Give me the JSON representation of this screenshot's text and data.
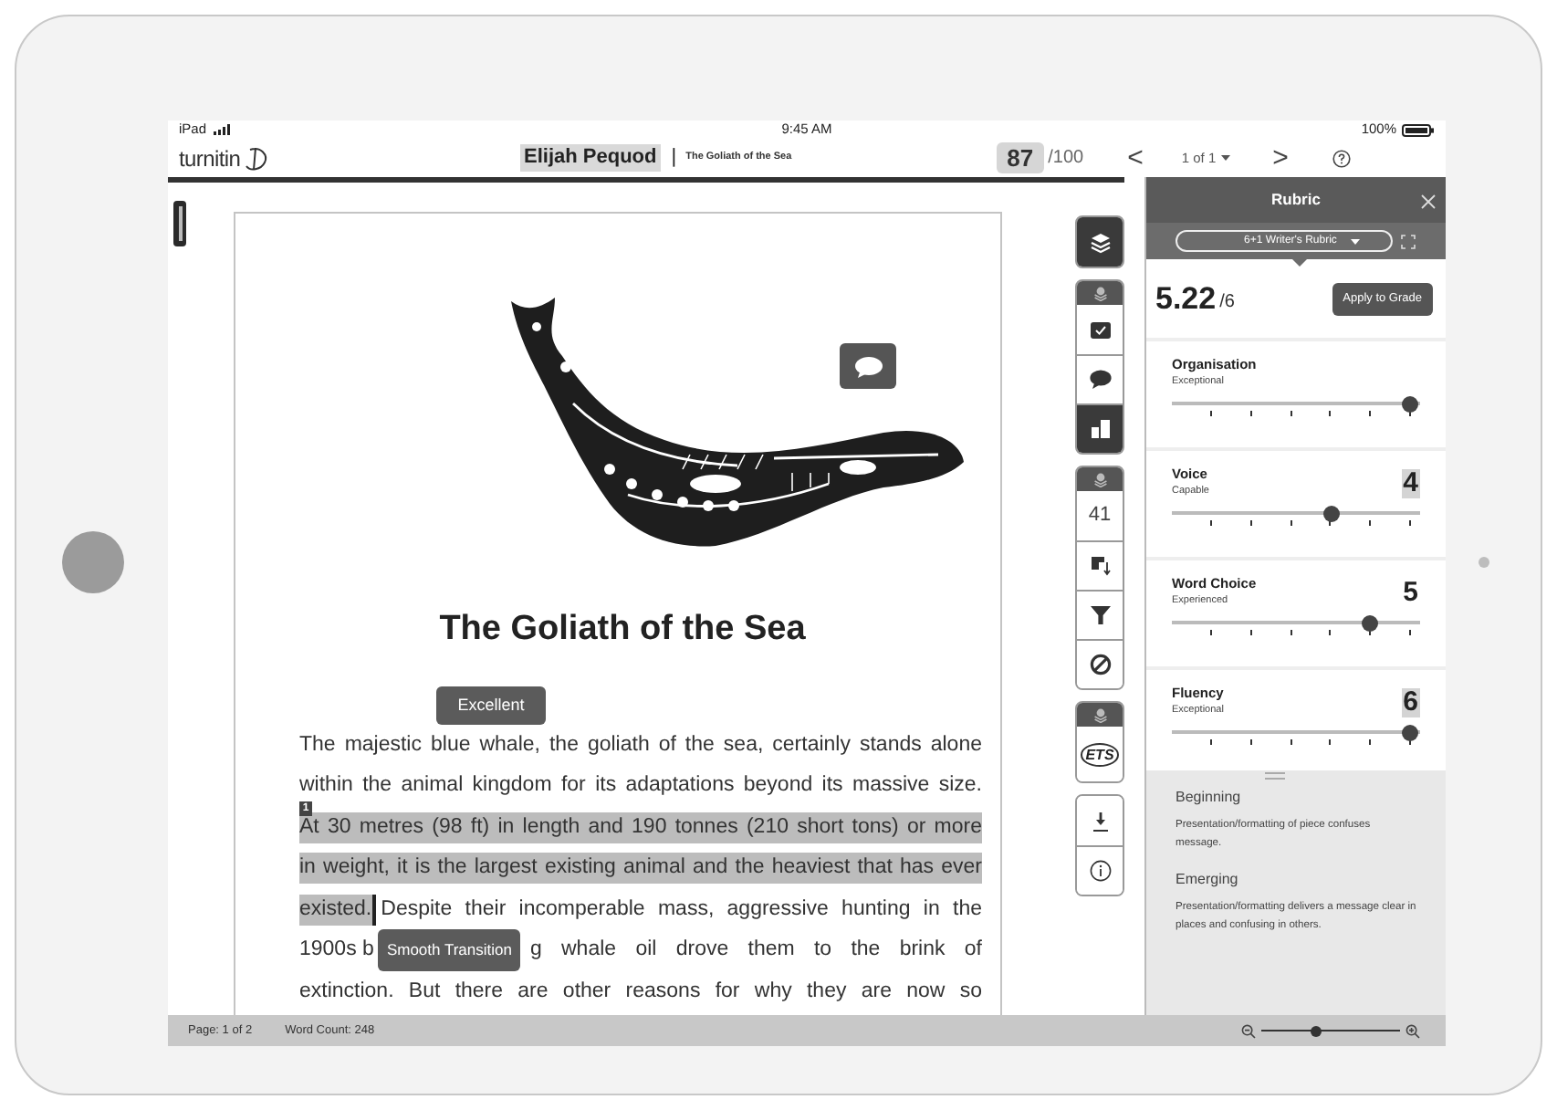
{
  "status_bar": {
    "device": "iPad",
    "time": "9:45 AM",
    "battery": "100%"
  },
  "top_bar": {
    "logo": "turnitin",
    "student": "Elijah Pequod",
    "separator": "|",
    "paper_title": "The Goliath of the Sea",
    "score": "87",
    "score_total": "/100",
    "prev": "<",
    "page_selector": "1 of 1",
    "next": ">"
  },
  "toolbar": {
    "groups": [
      {
        "items": [
          {
            "kind": "layers",
            "selected": true
          }
        ]
      },
      {
        "items": [
          {
            "kind": "header"
          },
          {
            "kind": "check",
            "selected": false
          },
          {
            "kind": "comment",
            "selected": false
          },
          {
            "kind": "chart",
            "selected": true
          }
        ]
      },
      {
        "items": [
          {
            "kind": "header"
          },
          {
            "kind": "count",
            "text": "41",
            "selected": false
          },
          {
            "kind": "sort",
            "selected": false
          },
          {
            "kind": "filter",
            "selected": false
          },
          {
            "kind": "block",
            "selected": false
          }
        ]
      },
      {
        "items": [
          {
            "kind": "header"
          },
          {
            "kind": "ets",
            "text": "ETS",
            "selected": false
          }
        ]
      },
      {
        "items": [
          {
            "kind": "download",
            "selected": false
          },
          {
            "kind": "info",
            "selected": false
          }
        ]
      }
    ]
  },
  "document": {
    "title": "The Goliath of the Sea",
    "grade_tag": "Excellent",
    "marker": "1",
    "lines": [
      {
        "segments": [
          {
            "text": "The majestic blue whale, the goliath of the sea, certainly stands alone",
            "highlighted": false
          }
        ]
      },
      {
        "segments": [
          {
            "text": "within the animal kingdom for its adaptations beyond its massive size.",
            "highlighted": false
          }
        ]
      },
      {
        "marked": true,
        "segments": [
          {
            "text": "At 30 metres (98 ft) in length and 190 tonnes (210 short tons) or more",
            "highlighted": true
          }
        ]
      },
      {
        "segments": [
          {
            "text": "in weight, it is the largest existing animal and the heaviest that has ever",
            "highlighted": true
          }
        ]
      },
      {
        "segments": [
          {
            "text": "existed.",
            "highlighted": true,
            "cursor": true
          },
          {
            "text": "Despite their incomperable mass, aggressive hunting in the",
            "highlighted": false
          }
        ]
      },
      {
        "tag": "Smooth Transition",
        "segments": [
          {
            "text": "1900s b",
            "highlighted": false
          },
          {
            "text": "g whale oil drove them to the brink of",
            "highlighted": false
          }
        ]
      },
      {
        "segments": [
          {
            "text": "extinction. But there are other reasons for why they are now so",
            "highlighted": false
          }
        ]
      }
    ]
  },
  "rubric": {
    "title": "Rubric",
    "selector": "6+1 Writer's Rubric",
    "score": "5.22",
    "score_max": "/6",
    "apply_button": "Apply to Grade",
    "criteria": [
      {
        "name": "Organisation",
        "rating": "Exceptional",
        "level": 1
      },
      {
        "name": "Voice",
        "rating": "Capable",
        "score": "4",
        "highlighted": true,
        "level": 0.667
      },
      {
        "name": "Word Choice",
        "rating": "Experienced",
        "score": "5",
        "highlighted": false,
        "level": 0.833
      },
      {
        "name": "Fluency",
        "rating": "Exceptional",
        "score": "6",
        "highlighted": true,
        "level": 1
      }
    ],
    "descriptions": [
      {
        "heading": "Beginning",
        "text": "Presentation/formatting of piece confuses message."
      },
      {
        "heading": "Emerging",
        "text": "Presentation/formatting delivers a message clear in places and confusing in others."
      }
    ]
  },
  "footer": {
    "page": "Page: 1 of 2",
    "word_count": "Word Count: 248",
    "zoom": {
      "level": 0.4
    }
  }
}
